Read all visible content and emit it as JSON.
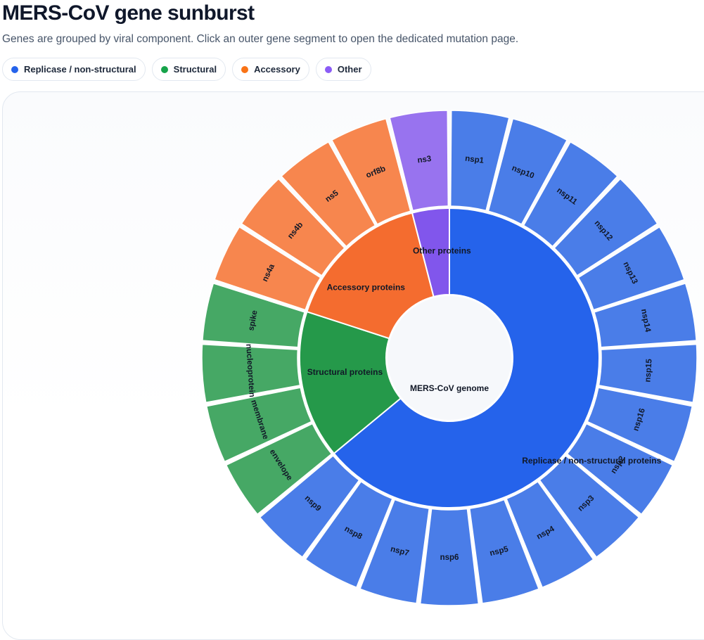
{
  "page": {
    "title": "MERS-CoV gene sunburst",
    "subtitle": "Genes are grouped by viral component. Click an outer gene segment to open the dedicated mutation page."
  },
  "legend": [
    {
      "label": "Replicase / non-structural",
      "color": "#2563eb"
    },
    {
      "label": "Structural",
      "color": "#16a34a"
    },
    {
      "label": "Accessory",
      "color": "#f97316"
    },
    {
      "label": "Other",
      "color": "#8b5cf6"
    }
  ],
  "chart_data": {
    "type": "sunburst",
    "root": "MERS-CoV genome",
    "groups": [
      {
        "name": "Replicase / non-structural proteins",
        "inner_color": "#2563eb",
        "outer_color": "#4a7de8",
        "genes": [
          "nsp1",
          "nsp10",
          "nsp11",
          "nsp12",
          "nsp13",
          "nsp14",
          "nsp15",
          "nsp16",
          "nsp2",
          "nsp3",
          "nsp4",
          "nsp5",
          "nsp6",
          "nsp7",
          "nsp8",
          "nsp9"
        ]
      },
      {
        "name": "Structural proteins",
        "inner_color": "#25994a",
        "outer_color": "#46a865",
        "genes": [
          "envelope",
          "membrane",
          "nucleoprotein",
          "spike"
        ]
      },
      {
        "name": "Accessory proteins",
        "inner_color": "#f46c2f",
        "outer_color": "#f7864e",
        "genes": [
          "ns4a",
          "ns4b",
          "ns5",
          "orf8b"
        ]
      },
      {
        "name": "Other proteins",
        "inner_color": "#8156ec",
        "outer_color": "#9873ef",
        "genes": [
          "ns3"
        ]
      }
    ]
  }
}
